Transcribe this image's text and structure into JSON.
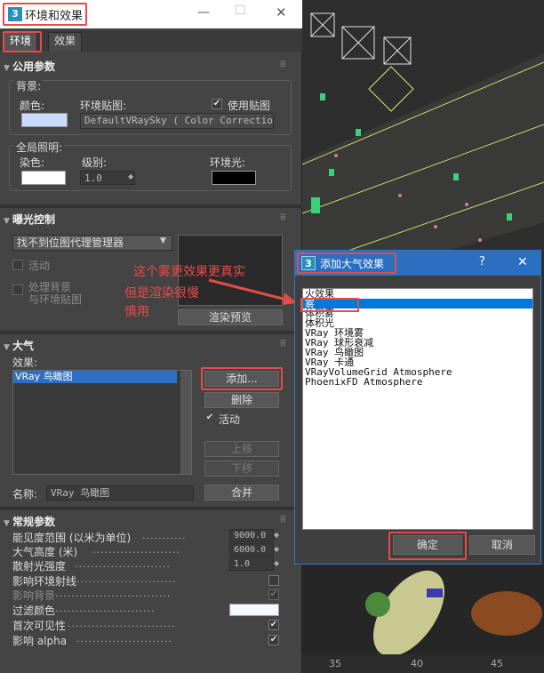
{
  "window": {
    "title": "环境和效果",
    "tabs": [
      "环境",
      "效果"
    ]
  },
  "common": {
    "header": "公用参数",
    "bg_label": "背景:",
    "color_label": "颜色:",
    "map_label": "环境贴图:",
    "use_map_label": "使用贴图",
    "map_value": "DefaultVRaySky  ( Color Correction )",
    "gi_label": "全局照明:",
    "tint_label": "染色:",
    "level_label": "级别:",
    "level_value": "1.0",
    "ambient_label": "环境光:"
  },
  "exposure": {
    "header": "曝光控制",
    "dropdown": "找不到位图代理管理器",
    "active": "活动",
    "process_bg": "处理背景",
    "with_env": "与环境贴图",
    "render_preview": "渲染预览"
  },
  "atmosphere": {
    "header": "大气",
    "effects_label": "效果:",
    "effects": [
      "VRay 鸟瞰图"
    ],
    "add": "添加...",
    "delete": "删除",
    "active": "活动",
    "move_up": "上移",
    "move_down": "下移",
    "name_label": "名称:",
    "name_value": "VRay 鸟瞰图",
    "merge": "合并"
  },
  "params": {
    "header": "常规参数",
    "rows": [
      {
        "label": "能见度范围 (以米为单位)",
        "value": "9000.0"
      },
      {
        "label": "大气高度 (米)",
        "value": "6000.0"
      },
      {
        "label": "散射光强度",
        "value": "1.0"
      }
    ],
    "checks": [
      {
        "label": "影响环境射线",
        "checked": false,
        "dim": false
      },
      {
        "label": "影响背景",
        "checked": true,
        "dim": true
      }
    ],
    "filter_color": "过滤颜色",
    "checks2": [
      {
        "label": "首次可见性",
        "checked": true
      },
      {
        "label": "影响 alpha",
        "checked": true
      }
    ]
  },
  "dialog": {
    "title": "添加大气效果",
    "help": "?",
    "close": "✕",
    "items": [
      "火效果",
      "雾",
      "体积雾",
      "体积光",
      "VRay 环境雾",
      "VRay 球形衰减",
      "VRay 鸟瞰图",
      "VRay 卡通",
      "VRayVolumeGrid Atmosphere",
      "PhoenixFD Atmosphere"
    ],
    "ok": "确定",
    "cancel": "取消"
  },
  "annotations": {
    "line1": "这个雾更效果更真实",
    "line2": "但是渲染很慢",
    "line3": "慎用"
  },
  "ruler": [
    "35",
    "40",
    "45"
  ],
  "colors": {
    "accent_red": "#e84a4a",
    "dialog_blue": "#2b6fc1",
    "bg_swatch": "#c9dcff",
    "highlight": "#0078d7"
  }
}
